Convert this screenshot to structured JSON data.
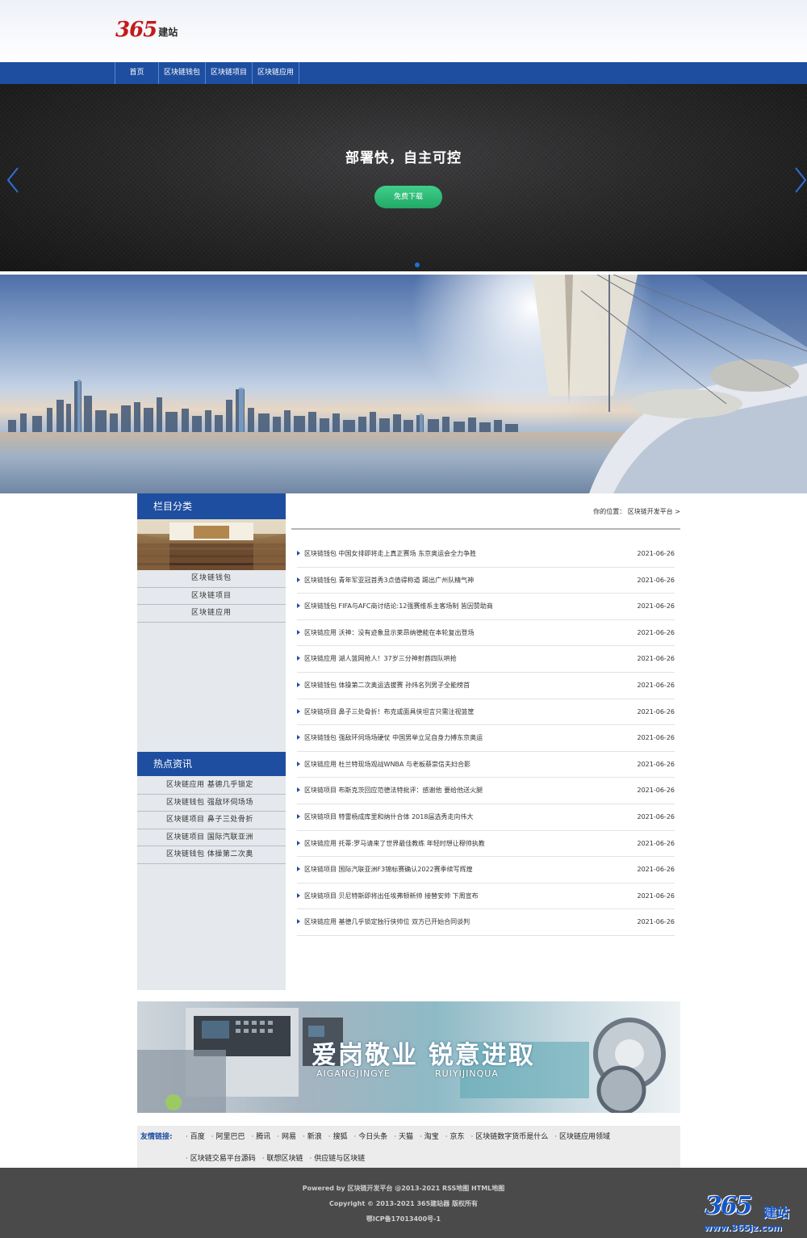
{
  "logo": {
    "number": "365",
    "text": "建站"
  },
  "nav": [
    "首页",
    "区块链钱包",
    "区块链项目",
    "区块链应用"
  ],
  "hero": {
    "title": "部署快，自主可控",
    "button": "免费下载"
  },
  "sidebar": {
    "category_title": "栏目分类",
    "categories": [
      "区块链钱包",
      "区块链项目",
      "区块链应用"
    ],
    "hot_title": "热点资讯",
    "hot": [
      "区块链应用 基德几乎锁定",
      "区块链钱包 强敌环伺场场",
      "区块链项目 鼻子三处骨折",
      "区块链项目 国际汽联亚洲",
      "区块链钱包 体操第二次奥"
    ]
  },
  "breadcrumb": "你的位置： 区块链开发平台 >",
  "news": [
    {
      "title": "区块链钱包 中国女排即将走上真正赛场 东京奥运会全力争胜",
      "date": "2021-06-26"
    },
    {
      "title": "区块链钱包 青年军亚冠首秀3点值得称道 踢出广州队精气神",
      "date": "2021-06-26"
    },
    {
      "title": "区块链钱包 FIFA与AFC商讨结论:12强赛维系主客场制 皆因赞助商",
      "date": "2021-06-26"
    },
    {
      "title": "区块链应用 沃神：没有迹象显示莱昂纳德能在本轮复出登场",
      "date": "2021-06-26"
    },
    {
      "title": "区块链应用 湖人篮网抢人！37岁三分神射酋四队哄抢",
      "date": "2021-06-26"
    },
    {
      "title": "区块链钱包 体操第二次奥运选拔赛 孙炜名列男子全能榜首",
      "date": "2021-06-26"
    },
    {
      "title": "区块链项目 鼻子三处骨折！布克或面具侠坦言只需注视篮筐",
      "date": "2021-06-26"
    },
    {
      "title": "区块链钱包 强敌环伺场场硬仗 中国男举立足自身力搏东京奥运",
      "date": "2021-06-26"
    },
    {
      "title": "区块链应用 杜兰特现场观战WNBA 与老板蔡崇信夫妇合影",
      "date": "2021-06-26"
    },
    {
      "title": "区块链项目 布斯克茨回应范德法特批评：感谢他 要给他送火腿",
      "date": "2021-06-26"
    },
    {
      "title": "区块链项目 特雷杨成库里和纳什合体 2018届选秀走向伟大",
      "date": "2021-06-26"
    },
    {
      "title": "区块链应用 托蒂:罗马请来了世界最佳教练 年轻时想让穆帅执教",
      "date": "2021-06-26"
    },
    {
      "title": "区块链项目 国际汽联亚洲F3锦标赛确认2022赛季续写辉煌",
      "date": "2021-06-26"
    },
    {
      "title": "区块链项目 贝尼特斯即将出任埃弗顿新帅 接替安帅 下周宣布",
      "date": "2021-06-26"
    },
    {
      "title": "区块链应用 基德几乎锁定独行侠帅位 双方已开始合同谈判",
      "date": "2021-06-26"
    }
  ],
  "ad": {
    "headline": "爱岗敬业  锐意进取",
    "sub_left": "AIGANGJINGYE",
    "sub_right": "RUIYIJINQUA"
  },
  "links": {
    "label": "友情链接:",
    "row1": [
      "百度",
      "阿里巴巴",
      "腾讯",
      "网易",
      "新浪",
      "搜狐",
      "今日头条",
      "天猫",
      "淘宝",
      "京东",
      "区块链数字货币是什么",
      "区块链应用领域"
    ],
    "row2": [
      "区块链交易平台源码",
      "联想区块链",
      "供应链与区块链"
    ]
  },
  "footer": {
    "line1": "Powered by 区块链开发平台 @2013-2021 RSS地图 HTML地图",
    "line2": "Copyright © 2013-2021 365建站器 版权所有",
    "line3": "鄂ICP备17013400号-1"
  },
  "watermark": {
    "number": "365",
    "text": "建站",
    "url": "www.365jz.com"
  },
  "colors": {
    "primary": "#1e4ea0",
    "button": "#2fbf78",
    "logo_red": "#c41a1a"
  }
}
